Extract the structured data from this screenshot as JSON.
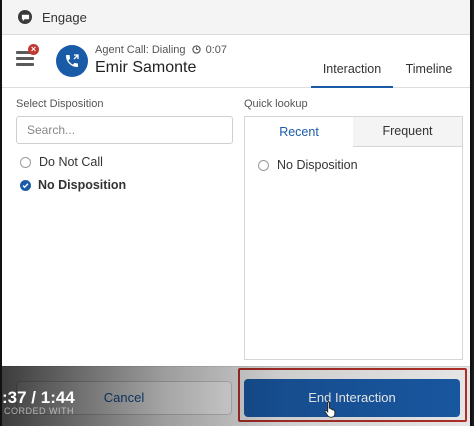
{
  "window": {
    "title": "Engage"
  },
  "header": {
    "badge_count": "×",
    "call_status": "Agent Call: Dialing",
    "call_timer": "0:07",
    "caller_name": "Emir Samonte",
    "tabs": [
      {
        "label": "Interaction",
        "active": true
      },
      {
        "label": "Timeline",
        "active": false
      }
    ]
  },
  "disposition": {
    "label": "Select Disposition",
    "search_placeholder": "Search...",
    "options": [
      {
        "label": "Do Not Call",
        "selected": false
      },
      {
        "label": "No Disposition",
        "selected": true
      }
    ]
  },
  "quick_lookup": {
    "label": "Quick lookup",
    "tabs": [
      {
        "label": "Recent",
        "active": true
      },
      {
        "label": "Frequent",
        "active": false
      }
    ],
    "options": [
      {
        "label": "No Disposition",
        "selected": false
      }
    ]
  },
  "footer": {
    "cancel_label": "Cancel",
    "end_label": "End Interaction"
  },
  "video": {
    "time": ":37 / 1:44",
    "watermark": "CORDED WITH"
  },
  "colors": {
    "accent": "#1a5ba8",
    "badge": "#c23934",
    "highlight": "#b5302a"
  }
}
